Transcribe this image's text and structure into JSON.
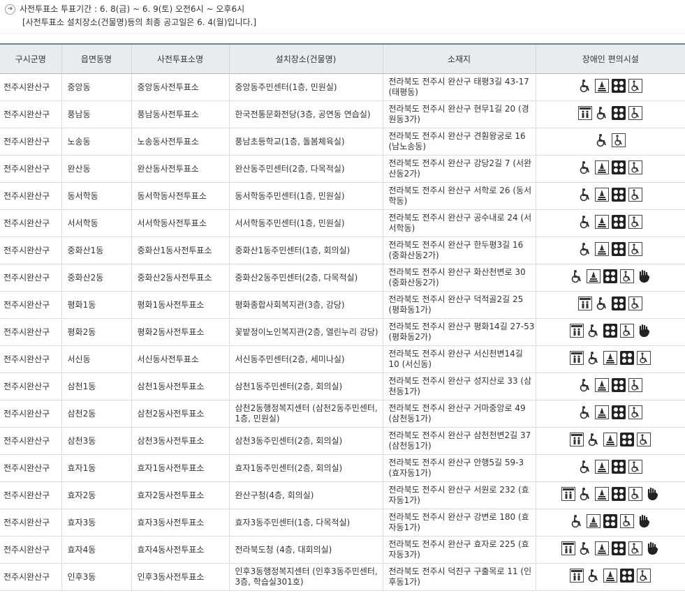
{
  "notice": {
    "line1": "사전투표소 투표기간 : 6. 8(금) ~ 6. 9(토) 오전6시 ~ 오후6시",
    "line2": "[사전투표소 설치장소(건물명)등의 최종 공고일은 6. 4(월)입니다.]"
  },
  "headers": [
    "구시군명",
    "읍면동명",
    "사전투표소명",
    "설치장소(건물명)",
    "소재지",
    "장애인 편의시설"
  ],
  "icon_names": {
    "E": "elevator-icon",
    "W": "wheelchair-icon",
    "B": "bell-icon",
    "D": "dots-icon",
    "R": "ramp-wheelchair-icon",
    "H": "sign-language-icon"
  },
  "rows": [
    {
      "gu": "전주시완산구",
      "dong": "중앙동",
      "name": "중앙동사전투표소",
      "place": "중앙동주민센터(1층, 민원실)",
      "addr": "전라북도 전주시 완산구 태평3길 43-17 (태평동)",
      "icons": [
        "W",
        "B",
        "D",
        "R"
      ]
    },
    {
      "gu": "전주시완산구",
      "dong": "풍남동",
      "name": "풍남동사전투표소",
      "place": "한국전통문화전당(3층, 공연동 연습실)",
      "addr": "전라북도 전주시 완산구 현무1길 20 (경원동3가)",
      "icons": [
        "E",
        "W",
        "D",
        "R"
      ]
    },
    {
      "gu": "전주시완산구",
      "dong": "노송동",
      "name": "노송동사전투표소",
      "place": "풍남초등학교(1층, 돌봄체육실)",
      "addr": "전라북도 전주시 완산구 견훤왕궁로 16 (남노송동)",
      "icons": [
        "W",
        "R"
      ]
    },
    {
      "gu": "전주시완산구",
      "dong": "완산동",
      "name": "완산동사전투표소",
      "place": "완산동주민센터(2층, 다목적실)",
      "addr": "전라북도 전주시 완산구 강당2길 7 (서완산동2가)",
      "icons": [
        "W",
        "B",
        "D",
        "R"
      ]
    },
    {
      "gu": "전주시완산구",
      "dong": "동서학동",
      "name": "동서학동사전투표소",
      "place": "동서학동주민센터(1층, 민원실)",
      "addr": "전라북도 전주시 완산구 서학로 26 (동서학동)",
      "icons": [
        "W",
        "B",
        "D",
        "R"
      ]
    },
    {
      "gu": "전주시완산구",
      "dong": "서서학동",
      "name": "서서학동사전투표소",
      "place": "서서학동주민센터(1층, 민원실)",
      "addr": "전라북도 전주시 완산구 공수내로 24 (서서학동)",
      "icons": [
        "W",
        "B",
        "D",
        "R"
      ]
    },
    {
      "gu": "전주시완산구",
      "dong": "중화산1동",
      "name": "중화산1동사전투표소",
      "place": "중화산1동주민센터(1층, 회의실)",
      "addr": "전라북도 전주시 완산구 한두평3길 16 (중화산동2가)",
      "icons": [
        "W",
        "B",
        "D",
        "R"
      ]
    },
    {
      "gu": "전주시완산구",
      "dong": "중화산2동",
      "name": "중화산2동사전투표소",
      "place": "중화산2동주민센터(2층, 다목적실)",
      "addr": "전라북도 전주시 완산구 화산천변로 30 (중화산동2가)",
      "icons": [
        "W",
        "B",
        "D",
        "R",
        "H"
      ]
    },
    {
      "gu": "전주시완산구",
      "dong": "평화1동",
      "name": "평화1동사전투표소",
      "place": "평화종합사회복지관(3층, 강당)",
      "addr": "전라북도 전주시 완산구 덕적골2길 25 (평화동1가)",
      "icons": [
        "E",
        "W",
        "D",
        "R"
      ]
    },
    {
      "gu": "전주시완산구",
      "dong": "평화2동",
      "name": "평화2동사전투표소",
      "place": "꽃밭정이노인복지관(2층, 열린누리 강당)",
      "addr": "전라북도 전주시 완산구 평화14길 27-53 (평화동2가)",
      "icons": [
        "E",
        "W",
        "D",
        "R",
        "H"
      ]
    },
    {
      "gu": "전주시완산구",
      "dong": "서신동",
      "name": "서신동사전투표소",
      "place": "서신동주민센터(2층, 세미나실)",
      "addr": "전라북도 전주시 완산구 서신천변14길 10 (서신동)",
      "icons": [
        "E",
        "W",
        "B",
        "D",
        "R"
      ]
    },
    {
      "gu": "전주시완산구",
      "dong": "삼천1동",
      "name": "삼천1동사전투표소",
      "place": "삼천1동주민센터(2층, 회의실)",
      "addr": "전라북도 전주시 완산구 성지산로 33 (삼천동1가)",
      "icons": [
        "W",
        "B",
        "D",
        "R"
      ]
    },
    {
      "gu": "전주시완산구",
      "dong": "삼천2동",
      "name": "삼천2동사전투표소",
      "place": "삼천2동행정복지센터 (삼천2동주민센터, 1층, 민원실)",
      "addr": "전라북도 전주시 완산구 거마중앙로 49 (삼천동1가)",
      "icons": [
        "W",
        "B",
        "D",
        "R"
      ]
    },
    {
      "gu": "전주시완산구",
      "dong": "삼천3동",
      "name": "삼천3동사전투표소",
      "place": "삼천3동주민센터(2층, 회의실)",
      "addr": "전라북도 전주시 완산구 삼천천변2길 37 (삼천동1가)",
      "icons": [
        "E",
        "W",
        "B",
        "D",
        "R"
      ]
    },
    {
      "gu": "전주시완산구",
      "dong": "효자1동",
      "name": "효자1동사전투표소",
      "place": "효자1동주민센터(2층, 회의실)",
      "addr": "전라북도 전주시 완산구 안행5길 59-3 (효자동1가)",
      "icons": [
        "W",
        "B",
        "D",
        "R"
      ]
    },
    {
      "gu": "전주시완산구",
      "dong": "효자2동",
      "name": "효자2동사전투표소",
      "place": "완산구청(4층, 회의실)",
      "addr": "전라북도 전주시 완산구 서원로 232 (효자동1가)",
      "icons": [
        "E",
        "W",
        "B",
        "D",
        "R",
        "H"
      ]
    },
    {
      "gu": "전주시완산구",
      "dong": "효자3동",
      "name": "효자3동사전투표소",
      "place": "효자3동주민센터(1층, 다목적실)",
      "addr": "전라북도 전주시 완산구 강변로 180 (효자동1가)",
      "icons": [
        "W",
        "B",
        "D",
        "R",
        "H"
      ]
    },
    {
      "gu": "전주시완산구",
      "dong": "효자4동",
      "name": "효자4동사전투표소",
      "place": "전라북도청 (4층, 대회의실)",
      "addr": "전라북도 전주시 완산구 효자로 225 (효자동3가)",
      "icons": [
        "E",
        "W",
        "B",
        "D",
        "R",
        "H"
      ]
    },
    {
      "gu": "전주시완산구",
      "dong": "인후3동",
      "name": "인후3동사전투표소",
      "place": "인후3동행정복지센터 (인후3동주민센터, 3층, 학습실301호)",
      "addr": "전라북도 전주시 덕진구 구출목로 11 (인후동1가)",
      "icons": [
        "E",
        "W",
        "B",
        "D",
        "R"
      ]
    }
  ]
}
